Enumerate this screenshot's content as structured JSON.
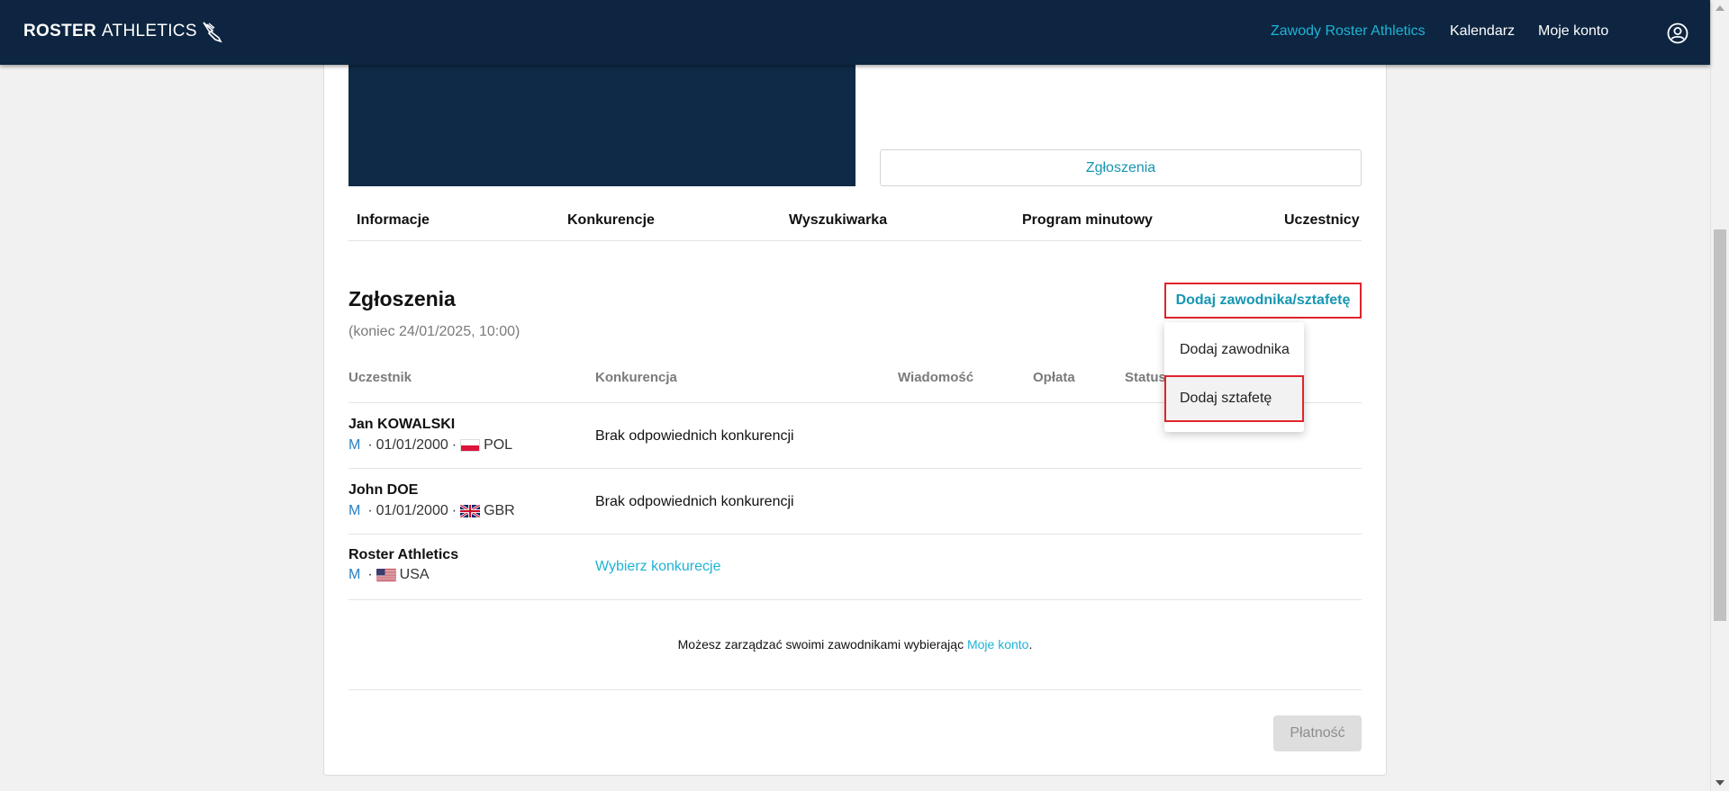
{
  "brand": {
    "bold": "ROSTER",
    "thin": "ATHLETICS"
  },
  "nav": {
    "items": [
      "Zawody Roster Athletics",
      "Kalendarz",
      "Moje konto"
    ]
  },
  "colors": {
    "navy": "#0d2540",
    "accent": "#1fb3d6",
    "highlight": "#e0242b"
  },
  "entries_button": "Zgłoszenia",
  "tabs": [
    "Informacje",
    "Konkurencje",
    "Wyszukiwarka",
    "Program minutowy",
    "Uczestnicy"
  ],
  "section": {
    "title": "Zgłoszenia",
    "deadline": "(koniec 24/01/2025, 10:00)",
    "add_button": "Dodaj zawodnika/sztafetę"
  },
  "dropdown": {
    "items": [
      "Dodaj zawodnika",
      "Dodaj sztafetę"
    ]
  },
  "table": {
    "headers": [
      "Uczestnik",
      "Konkurencja",
      "Wiadomość",
      "Opłata",
      "Status"
    ],
    "rows": [
      {
        "name": "Jan KOWALSKI",
        "gender": "M",
        "dob": "01/01/2000",
        "flag": "pol-flag",
        "country": "POL",
        "competition": "Brak odpowiednich konkurencji"
      },
      {
        "name": "John DOE",
        "gender": "M",
        "dob": "01/01/2000",
        "flag": "gbr-flag",
        "country": "GBR",
        "competition": "Brak odpowiednich konkurencji"
      },
      {
        "name": "Roster Athletics",
        "gender": "M",
        "flag": "usa-flag",
        "country": "USA",
        "competition": "Wybierz konkurecje"
      }
    ]
  },
  "note": {
    "text": "Możesz zarządzać swoimi zawodnikami wybierając",
    "link": "Moje konto",
    "end": "."
  },
  "pay_button": "Płatność",
  "icons": {
    "user": "user-circle-icon",
    "wing": "winged-shoe-icon"
  }
}
